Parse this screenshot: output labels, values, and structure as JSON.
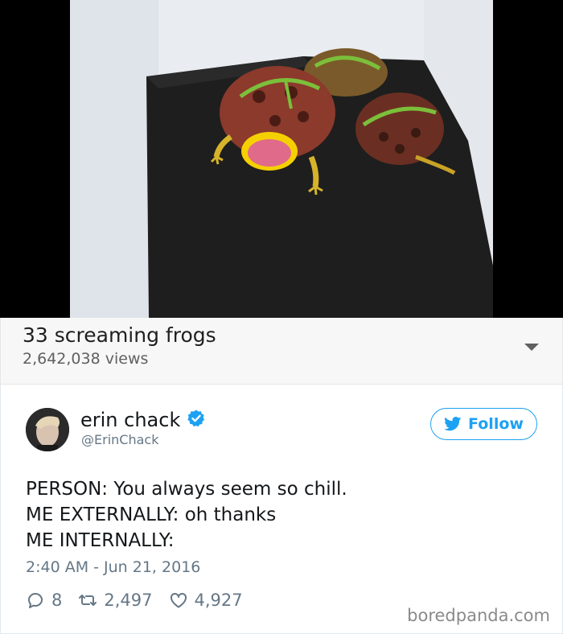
{
  "video": {
    "title": "33 screaming frogs",
    "views": "2,642,038 views"
  },
  "tweet": {
    "display_name": "erin chack",
    "handle": "@ErinChack",
    "follow_label": "Follow",
    "lines": [
      "PERSON: You always seem so chill.",
      "ME EXTERNALLY: oh thanks",
      "ME INTERNALLY:"
    ],
    "timestamp": "2:40 AM - Jun 21, 2016",
    "replies": "8",
    "retweets": "2,497",
    "likes": "4,927"
  },
  "watermark": "boredpanda.com",
  "icons": [
    "verified-icon",
    "twitter-bird-icon",
    "reply-icon",
    "retweet-icon",
    "like-icon",
    "chevron-down-icon"
  ],
  "colors": {
    "twitter_blue": "#1da1f2",
    "muted_text": "#657786",
    "frog_body": "#8b3a2c",
    "frog_pattern": "#7bbf3a",
    "frog_mouth": "#f5d000"
  }
}
